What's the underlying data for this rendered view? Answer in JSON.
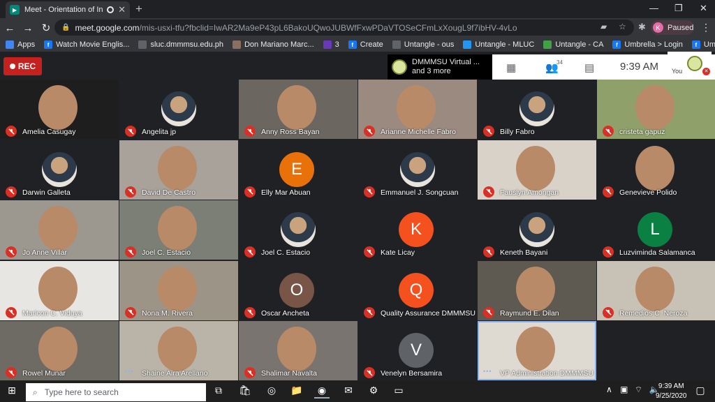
{
  "browser": {
    "tab_title": "Meet - Orientation of Interna",
    "url_host": "meet.google.com",
    "url_path": "/mis-usxi-tfu?fbclid=IwAR2Ma9eP43pL6BakoUQwoJUBWfFxwPDaVTOSeCFmLxXougL9f7ibHV-4vLo",
    "profile_initial": "K",
    "profile_status": "Paused",
    "bookmarks": [
      {
        "label": "Apps",
        "icon": "apps-grid",
        "color": "#4285f4"
      },
      {
        "label": "Watch Movie Englis...",
        "icon": "facebook-icon",
        "color": "#1877f2"
      },
      {
        "label": "sluc.dmmmsu.edu.ph",
        "icon": "globe-icon",
        "color": "#5f6368"
      },
      {
        "label": "Don Mariano Marc...",
        "icon": "school-icon",
        "color": "#8d6e63"
      },
      {
        "label": "3",
        "icon": "list-icon",
        "color": "#673ab7"
      },
      {
        "label": "Create",
        "icon": "facebook-icon",
        "color": "#1877f2"
      },
      {
        "label": "Untangle - ous",
        "icon": "untangle-icon",
        "color": "#5f6368"
      },
      {
        "label": "Untangle - MLUC",
        "icon": "s-icon",
        "color": "#2196f3"
      },
      {
        "label": "Untangle - CA",
        "icon": "untangle-icon",
        "color": "#43a047"
      },
      {
        "label": "Umbrella > Login",
        "icon": "facebook-icon",
        "color": "#1877f2"
      },
      {
        "label": "Umbrella > Login",
        "icon": "facebook-icon",
        "color": "#1877f2"
      }
    ]
  },
  "meet": {
    "rec_label": "REC",
    "presenter_name": "DMMMSU Virtual ...",
    "presenter_more": "and 3 more",
    "participant_count": "34",
    "time": "9:39 AM",
    "self_label": "You",
    "participants": [
      {
        "name": "Amelia Casugay",
        "kind": "video",
        "bg": "#1e1e1e"
      },
      {
        "name": "Angelita jp",
        "kind": "photo",
        "bg": "#202124"
      },
      {
        "name": "Anny Ross Bayan",
        "kind": "video",
        "bg": "#6b6660"
      },
      {
        "name": "Arianne Michelle Fabro",
        "kind": "video",
        "bg": "#9a8a80"
      },
      {
        "name": "Billy Fabro",
        "kind": "photo",
        "bg": "#202124"
      },
      {
        "name": "cristeta gapuz",
        "kind": "video",
        "bg": "#8fa06a"
      },
      {
        "name": "Darwin Galleta",
        "kind": "photo",
        "bg": "#202124"
      },
      {
        "name": "David De Castro",
        "kind": "video",
        "bg": "#a8a29a"
      },
      {
        "name": "Elly Mar Abuan",
        "kind": "letter",
        "letter": "E",
        "color": "#e8710a"
      },
      {
        "name": "Emmanuel J. Songcuan",
        "kind": "photo",
        "bg": "#202124"
      },
      {
        "name": "Fauslyn Amongan",
        "kind": "video",
        "bg": "#d8d2c8"
      },
      {
        "name": "Genevieve Polido",
        "kind": "video",
        "bg": "#202124"
      },
      {
        "name": "Jo Anne Villar",
        "kind": "video",
        "bg": "#9c9890"
      },
      {
        "name": "Joel C. Estacio",
        "kind": "video",
        "bg": "#7b7f75"
      },
      {
        "name": "Joel C. Estacio",
        "kind": "photo",
        "bg": "#202124"
      },
      {
        "name": "Kate Licay",
        "kind": "letter",
        "letter": "K",
        "color": "#f4511e"
      },
      {
        "name": "Keneth Bayani",
        "kind": "photo",
        "bg": "#202124"
      },
      {
        "name": "Luzviminda Salamanca",
        "kind": "letter",
        "letter": "L",
        "color": "#0b8043"
      },
      {
        "name": "Maricon C. Viduya",
        "kind": "video",
        "bg": "#e8e6e2"
      },
      {
        "name": "Nona M. Rivera",
        "kind": "video",
        "bg": "#9d9488"
      },
      {
        "name": "Oscar Ancheta",
        "kind": "letter",
        "letter": "O",
        "color": "#795548"
      },
      {
        "name": "Quality Assurance DMMMSU",
        "kind": "letter",
        "letter": "Q",
        "color": "#f4511e"
      },
      {
        "name": "Raymund E. Dilan",
        "kind": "video",
        "bg": "#5e5a52"
      },
      {
        "name": "Remedios C. Neroza",
        "kind": "video",
        "bg": "#c8c2b6"
      },
      {
        "name": "Rowel Munar",
        "kind": "video",
        "bg": "#6e6a64"
      },
      {
        "name": "Shaine Aira Arellano",
        "kind": "video",
        "bg": "#b9b3a8",
        "speaking": true
      },
      {
        "name": "Shalimar Navalta",
        "kind": "video",
        "bg": "#7a7470"
      },
      {
        "name": "Venelyn Bersamira",
        "kind": "letter",
        "letter": "V",
        "color": "#5f6368"
      },
      {
        "name": "VP Administration DMMMSU",
        "kind": "video",
        "bg": "#dedad2",
        "speaking": true,
        "highlight": true
      }
    ]
  },
  "taskbar": {
    "search_placeholder": "Type here to search",
    "time": "9:39 AM",
    "date": "9/25/2020"
  }
}
